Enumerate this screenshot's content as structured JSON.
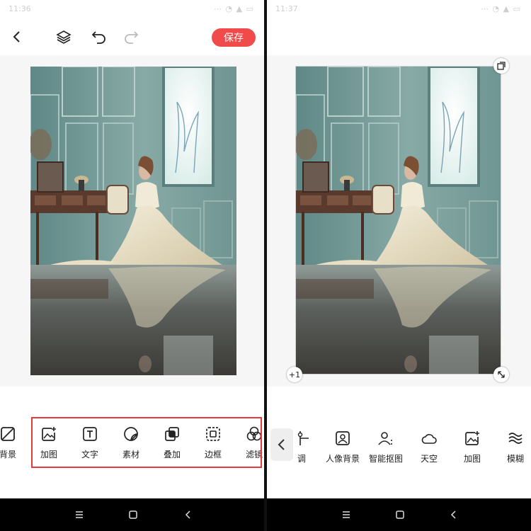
{
  "left_screen": {
    "status_time": "11:36",
    "status_right": "⋯ ◔ ▲ ▭",
    "save_label": "保存",
    "tools": [
      {
        "label": "背景",
        "icon": "background-icon"
      },
      {
        "label": "加图",
        "icon": "add-image-icon"
      },
      {
        "label": "文字",
        "icon": "text-icon"
      },
      {
        "label": "素材",
        "icon": "sticker-icon"
      },
      {
        "label": "叠加",
        "icon": "overlay-icon"
      },
      {
        "label": "边框",
        "icon": "frame-icon"
      },
      {
        "label": "滤镜",
        "icon": "filter-icon"
      }
    ]
  },
  "right_screen": {
    "status_time": "11:37",
    "status_right": "⋯ ◔ ▲ ▭",
    "plus_one_label": "+1",
    "tools": [
      {
        "label": "调",
        "icon": "adjust-icon"
      },
      {
        "label": "人像背景",
        "icon": "portrait-background-icon"
      },
      {
        "label": "智能抠图",
        "icon": "smart-cutout-icon"
      },
      {
        "label": "天空",
        "icon": "sky-icon"
      },
      {
        "label": "加图",
        "icon": "add-image-icon"
      },
      {
        "label": "模糊",
        "icon": "blur-icon"
      }
    ]
  },
  "colors": {
    "accent": "#f04a4a",
    "highlight": "#e6393a",
    "navbar": "#000000"
  }
}
